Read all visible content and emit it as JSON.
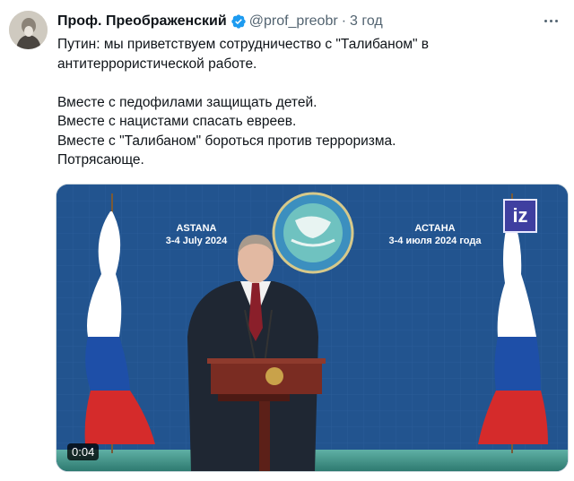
{
  "tweet": {
    "author_name": "Проф. Преображенский",
    "handle": "@prof_preobr",
    "separator": "·",
    "time": "3 год",
    "verified_color": "#1d9bf0",
    "text_lines": [
      "Путин: мы приветствуем сотрудничество с \"Талибаном\" в",
      "антитеррористической работе."
    ],
    "text_lines_2": [
      "Вместе с педофилами защищать детей.",
      "Вместе с нацистами спасать евреев.",
      "Вместе с \"Талибаном\" бороться против терроризма.",
      "Потрясающе."
    ]
  },
  "video": {
    "duration": "0:04",
    "logo_text": "iz",
    "banner_left_city": "ASTANA",
    "banner_left_date": "3-4 July 2024",
    "banner_right_city": "АСТАНА",
    "banner_right_date": "3-4 июля 2024 года",
    "background_color": "#22548f"
  }
}
